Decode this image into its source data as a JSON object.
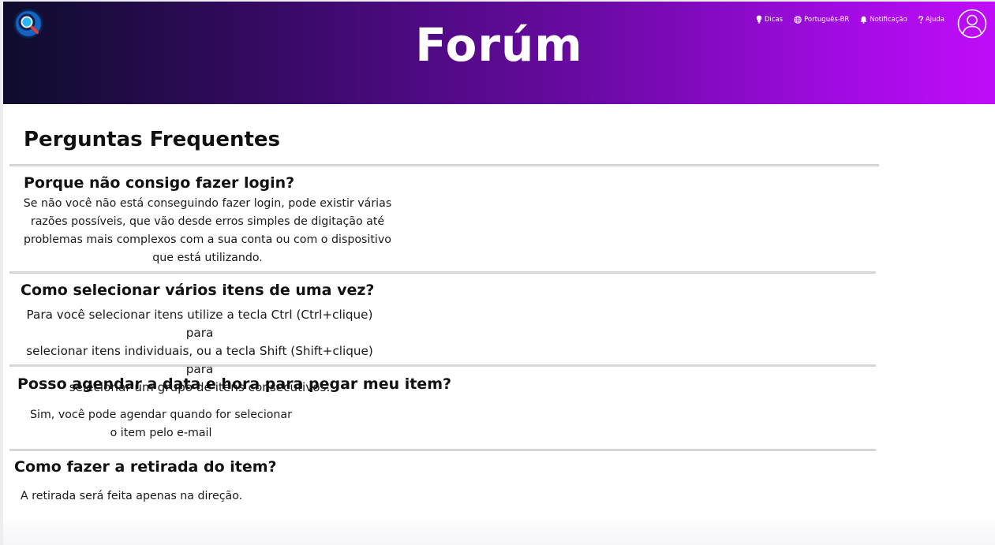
{
  "header": {
    "title": "Forúm",
    "nav": [
      {
        "label": "Dicas",
        "icon": "lightbulb-icon"
      },
      {
        "label": "Português-BR",
        "icon": "globe-icon"
      },
      {
        "label": "Notificação",
        "icon": "bell-icon"
      },
      {
        "label": "Ajuda",
        "icon": "question-icon"
      }
    ],
    "gradient_colors": [
      "#0e0c2c",
      "#6c0aa6",
      "#c00cf9"
    ]
  },
  "faq": {
    "heading": "Perguntas Frequentes",
    "items": [
      {
        "question": "Porque não consigo fazer login?",
        "answer_lines": [
          "Se não você não está conseguindo fazer login, pode existir várias",
          "razões possíveis, que vão desde erros simples de digitação até",
          "problemas mais complexos com a sua conta ou com o dispositivo",
          "que está utilizando."
        ]
      },
      {
        "question": "Como selecionar vários itens de uma vez?",
        "answer_lines": [
          "Para você selecionar itens utilize a tecla Ctrl (Ctrl+clique) para",
          "selecionar itens individuais, ou a tecla Shift (Shift+clique) para",
          "selecionar um grupo de itens consecutivos."
        ]
      },
      {
        "question": "Posso agendar a data e hora para pegar meu item?",
        "answer_lines": [
          "Sim, você pode agendar quando for selecionar",
          "o item pelo e-mail"
        ]
      },
      {
        "question": "Como fazer a retirada do item?",
        "answer_lines": [
          "A retirada será feita apenas na direção."
        ]
      }
    ]
  }
}
